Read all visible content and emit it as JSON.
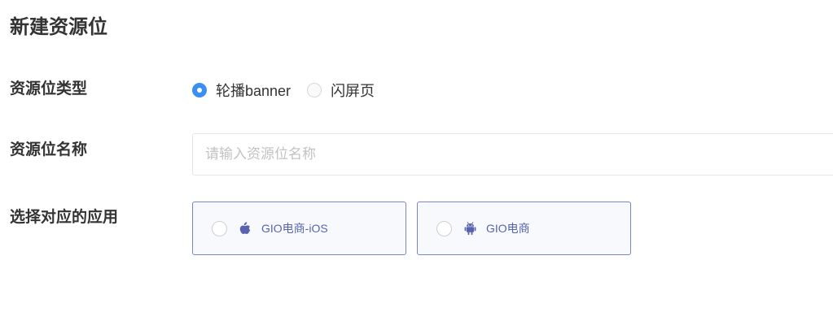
{
  "page": {
    "title": "新建资源位"
  },
  "form": {
    "type_label": "资源位类型",
    "type_options": [
      {
        "label": "轮播banner",
        "checked": true
      },
      {
        "label": "闪屏页",
        "checked": false
      }
    ],
    "name_label": "资源位名称",
    "name_placeholder": "请输入资源位名称",
    "name_value": "",
    "app_label": "选择对应的应用",
    "apps": [
      {
        "name": "GIO电商-iOS",
        "icon": "apple-icon",
        "selected": false
      },
      {
        "name": "GIO电商",
        "icon": "android-icon",
        "selected": false
      }
    ]
  },
  "colors": {
    "accent": "#3b8ff0",
    "card_border": "#7c85c4",
    "card_text": "#5863b0",
    "card_background": "#f8f9fd"
  }
}
